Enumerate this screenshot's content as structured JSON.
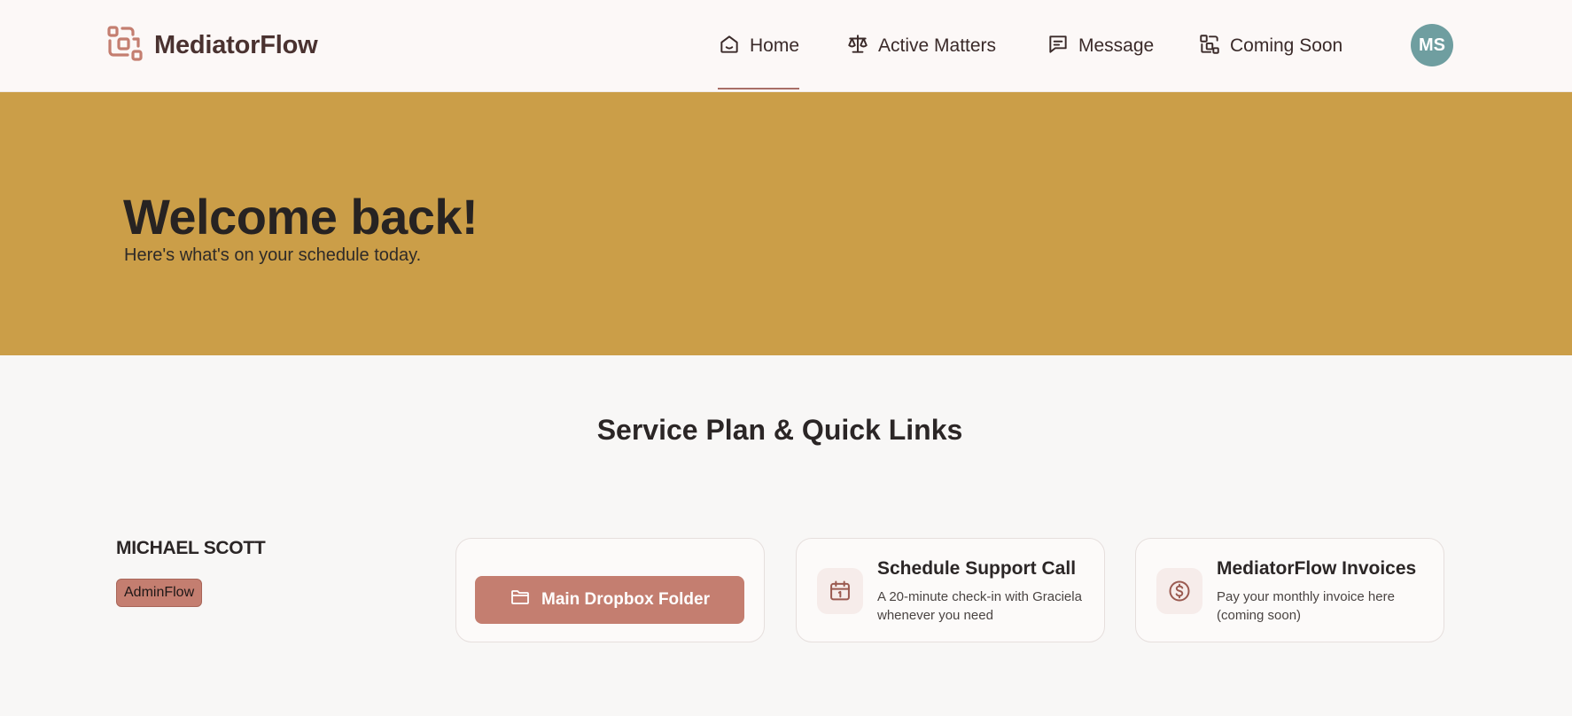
{
  "brand": {
    "name": "MediatorFlow",
    "logo_icon": "flow-nodes-icon"
  },
  "nav": {
    "items": [
      {
        "label": "Home",
        "icon": "home-icon",
        "active": true
      },
      {
        "label": "Active Matters",
        "icon": "scales-icon",
        "active": false
      },
      {
        "label": "Message",
        "icon": "message-icon",
        "active": false
      },
      {
        "label": "Coming Soon",
        "icon": "flow-icon",
        "active": false
      }
    ]
  },
  "user": {
    "initials": "MS",
    "name": "MICHAEL SCOTT",
    "plan_badge": "AdminFlow"
  },
  "hero": {
    "title": "Welcome back!",
    "subtitle": "Here's what's on your schedule today."
  },
  "section": {
    "title": "Service Plan & Quick Links"
  },
  "cards": {
    "dropbox": {
      "label": "Main Dropbox Folder",
      "icon": "folder-icon"
    },
    "support": {
      "title": "Schedule Support Call",
      "description": "A 20-minute check-in with Graciela whenever you need",
      "icon": "calendar-icon"
    },
    "invoices": {
      "title": "MediatorFlow Invoices",
      "description": "Pay your monthly invoice here (coming soon)",
      "icon": "dollar-icon"
    }
  },
  "colors": {
    "hero_bg": "#cb9e48",
    "accent": "#c47e70",
    "brand_text": "#4a3230",
    "avatar_bg": "#6f9ea0",
    "page_bg": "#f8f7f6"
  }
}
